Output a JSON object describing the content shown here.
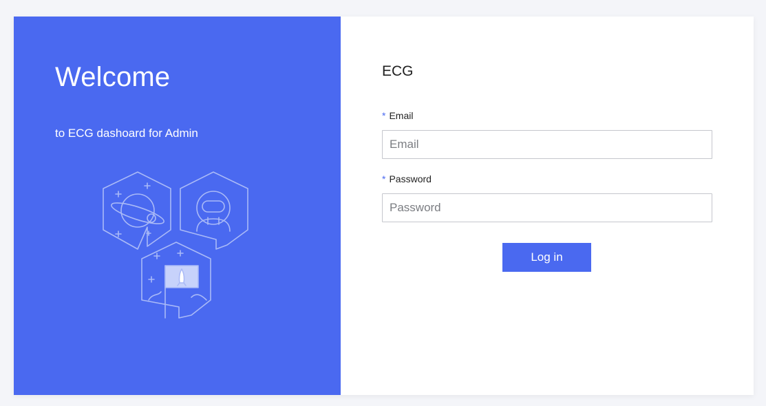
{
  "left_panel": {
    "heading": "Welcome",
    "subtitle": "to ECG dashoard for Admin",
    "illustration_icons": [
      "planet-icon",
      "astronaut-icon",
      "rocket-flag-icon"
    ]
  },
  "right_panel": {
    "brand": "ECG",
    "email": {
      "label": "Email",
      "required_mark": "*",
      "placeholder": "Email",
      "value": ""
    },
    "password": {
      "label": "Password",
      "required_mark": "*",
      "placeholder": "Password",
      "value": ""
    },
    "login_button": "Log in"
  },
  "colors": {
    "accent": "#4a69f0",
    "background": "#f4f5f9",
    "panel": "#ffffff",
    "input_border": "#c4c6cc"
  }
}
